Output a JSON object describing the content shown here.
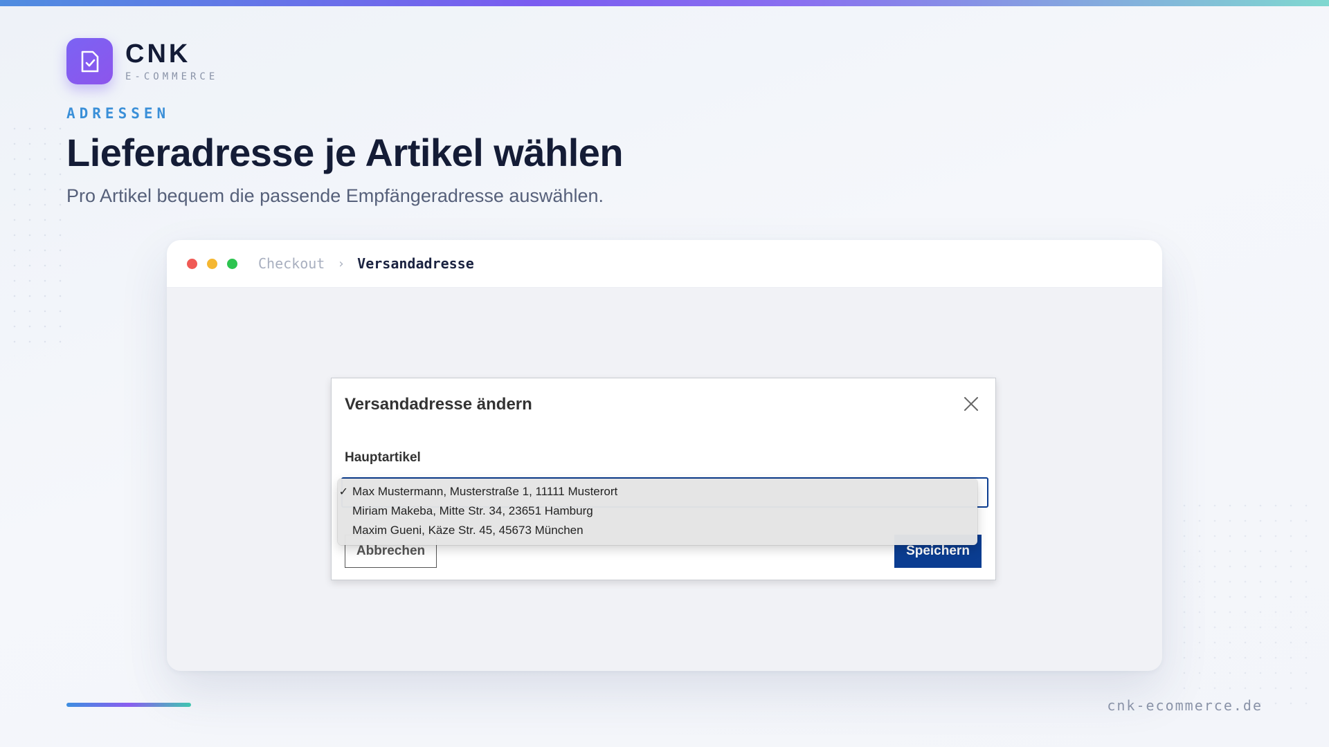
{
  "brand": {
    "name": "CNK",
    "tagline": "E-COMMERCE",
    "logo_icon": "document-check-icon",
    "accent": "#7b63f3"
  },
  "eyebrow": "ADRESSEN",
  "headline": "Lieferadresse je Artikel wählen",
  "subline": "Pro Artikel bequem die passende Empfängeradresse auswählen.",
  "window": {
    "breadcrumb": {
      "previous": "Checkout",
      "separator": "›",
      "current": "Versandadresse"
    }
  },
  "dialog": {
    "title": "Versandadresse ändern",
    "close_icon": "close-icon",
    "field_label": "Hauptartikel",
    "options": [
      {
        "label": "Max Mustermann, Musterstraße 1, 11111 Musterort",
        "selected": true,
        "check": "✓"
      },
      {
        "label": "Miriam Makeba, Mitte Str. 34, 23651 Hamburg",
        "selected": false,
        "check": ""
      },
      {
        "label": "Maxim Gueni, Käze Str. 45, 45673 München",
        "selected": false,
        "check": ""
      }
    ],
    "cancel_label": "Abbrechen",
    "save_label": "Speichern",
    "primary_color": "#0b3d91"
  },
  "footer": {
    "url": "cnk-ecommerce.de"
  }
}
